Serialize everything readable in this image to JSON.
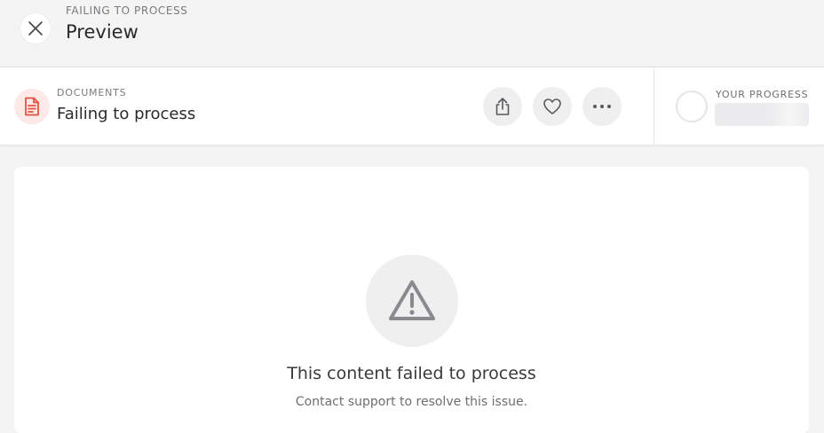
{
  "header": {
    "eyebrow": "FAILING TO PROCESS",
    "title": "Preview",
    "close_icon": "close-icon"
  },
  "document": {
    "eyebrow": "DOCUMENTS",
    "title": "Failing to process",
    "icon": "document-icon",
    "icon_color": "#e8503f",
    "actions": [
      {
        "name": "share",
        "icon": "share-icon"
      },
      {
        "name": "like",
        "icon": "heart-icon"
      },
      {
        "name": "more",
        "icon": "more-icon"
      }
    ]
  },
  "progress": {
    "label": "YOUR PROGRESS"
  },
  "error": {
    "icon": "warning-icon",
    "title": "This content failed to process",
    "message": "Contact support to resolve this issue."
  }
}
